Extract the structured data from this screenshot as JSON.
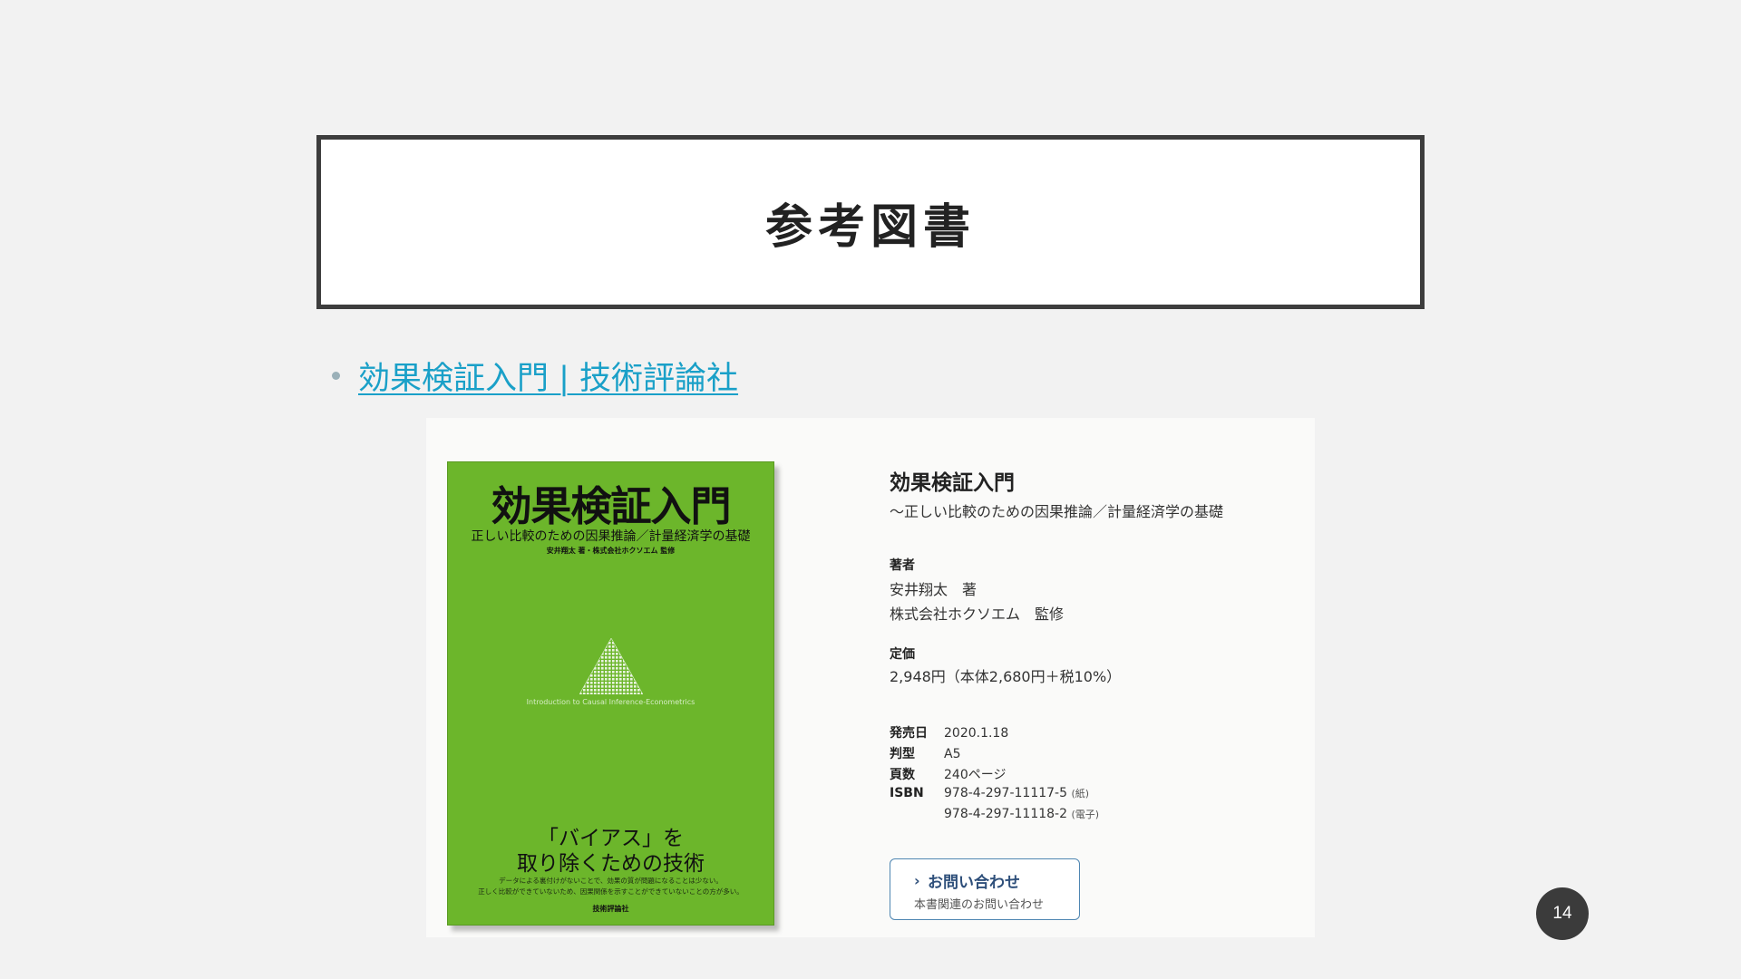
{
  "slide": {
    "title": "参考図書",
    "page_number": "14"
  },
  "bullet": {
    "link_text": "効果検証入門 | 技術評論社"
  },
  "book_cover": {
    "title": "効果検証入門",
    "subtitle": "正しい比較のための因果推論／計量経済学の基礎",
    "authors": "安井翔太 著・株式会社ホクソエム 監修",
    "english_title": "Introduction to Causal Inference-Econometrics",
    "tagline_line1": "「バイアス」を",
    "tagline_line2": "取り除くための技術",
    "note_line1": "データによる裏付けがないことで、効果の質が問題になることは少ない。",
    "note_line2": "正しく比較ができていないため、因果関係を示すことができていないことの方が多い。",
    "publisher": "技術評論社",
    "cover_color": "#6cb62b"
  },
  "book_info": {
    "title": "効果検証入門",
    "subtitle": "〜正しい比較のための因果推論／計量経済学の基礎",
    "author_label": "著者",
    "author_line1": "安井翔太　著",
    "author_line2": "株式会社ホクソエム　監修",
    "price_label": "定価",
    "price_value": "2,948円（本体2,680円＋税10%）",
    "specs": {
      "release_label": "発売日",
      "release_value": "2020.1.18",
      "format_label": "判型",
      "format_value": "A5",
      "pages_label": "頁数",
      "pages_value": "240ページ",
      "isbn_label": "ISBN",
      "isbn_paper": "978-4-297-11117-5",
      "isbn_paper_note": "(紙)",
      "isbn_ebook": "978-4-297-11118-2",
      "isbn_ebook_note": "(電子)"
    },
    "contact_button": {
      "label": "お問い合わせ",
      "sublabel": "本書関連のお問い合わせ",
      "chevron_icon": "chevron-right-icon"
    }
  },
  "colors": {
    "link": "#1aa0c8",
    "title_border": "#3d3d3d",
    "background": "#f2f2f2",
    "button_border": "#4f86b2"
  }
}
